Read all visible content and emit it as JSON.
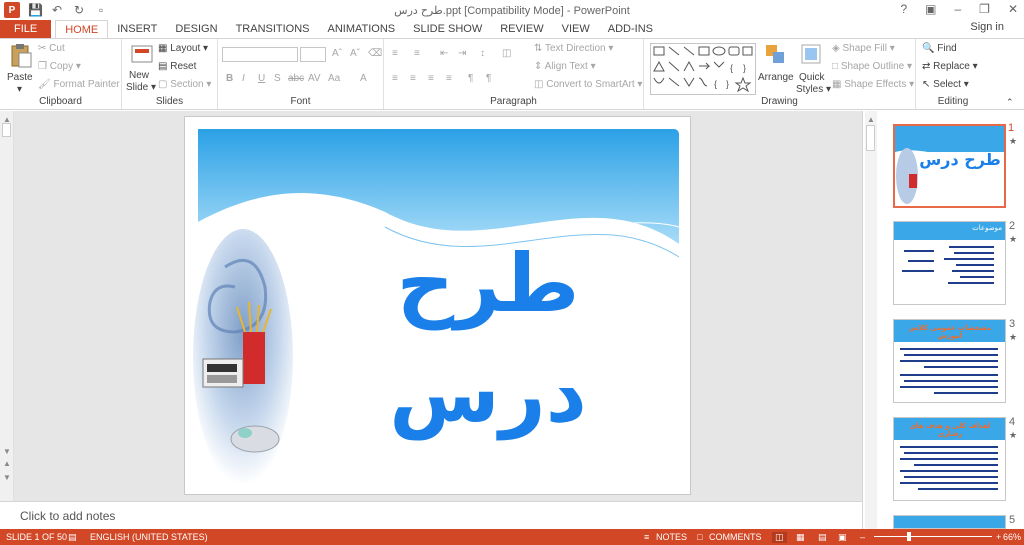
{
  "window": {
    "title": "طرح درس.ppt [Compatibility Mode] - PowerPoint",
    "help": "?",
    "sign_in": "Sign in"
  },
  "tabs": [
    "FILE",
    "HOME",
    "INSERT",
    "DESIGN",
    "TRANSITIONS",
    "ANIMATIONS",
    "SLIDE SHOW",
    "REVIEW",
    "VIEW",
    "ADD-INS"
  ],
  "ribbon": {
    "clipboard": {
      "label": "Clipboard",
      "paste": "Paste",
      "cut": "Cut",
      "copy": "Copy",
      "format_painter": "Format Painter"
    },
    "slides": {
      "label": "Slides",
      "new_slide": "New",
      "new_slide2": "Slide",
      "layout": "Layout",
      "reset": "Reset",
      "section": "Section"
    },
    "font": {
      "label": "Font"
    },
    "paragraph": {
      "label": "Paragraph",
      "text_direction": "Text Direction",
      "align_text": "Align Text",
      "smartart": "Convert to SmartArt"
    },
    "drawing": {
      "label": "Drawing",
      "arrange": "Arrange",
      "quick_styles": "Quick",
      "quick_styles2": "Styles",
      "shape_fill": "Shape Fill",
      "shape_outline": "Shape Outline",
      "shape_effects": "Shape Effects"
    },
    "editing": {
      "label": "Editing",
      "find": "Find",
      "replace": "Replace",
      "select": "Select"
    }
  },
  "slide": {
    "title_text": "طرح درس"
  },
  "thumbnails": [
    {
      "num": "1",
      "title": "طرح درس"
    },
    {
      "num": "2",
      "title": "موضوعات"
    },
    {
      "num": "3",
      "title": "مشخصات عمومی کلاس آموزش"
    },
    {
      "num": "4",
      "title": "اهداف کلی و هدف های رفتاری"
    },
    {
      "num": "5",
      "title": ""
    }
  ],
  "notes_placeholder": "Click to add notes",
  "status": {
    "slide_of": "SLIDE 1 OF 50",
    "language": "ENGLISH (UNITED STATES)",
    "notes": "NOTES",
    "comments": "COMMENTS",
    "zoom": "66%"
  },
  "colors": {
    "accent": "#d24726",
    "slide_title": "#1a7fe8"
  }
}
